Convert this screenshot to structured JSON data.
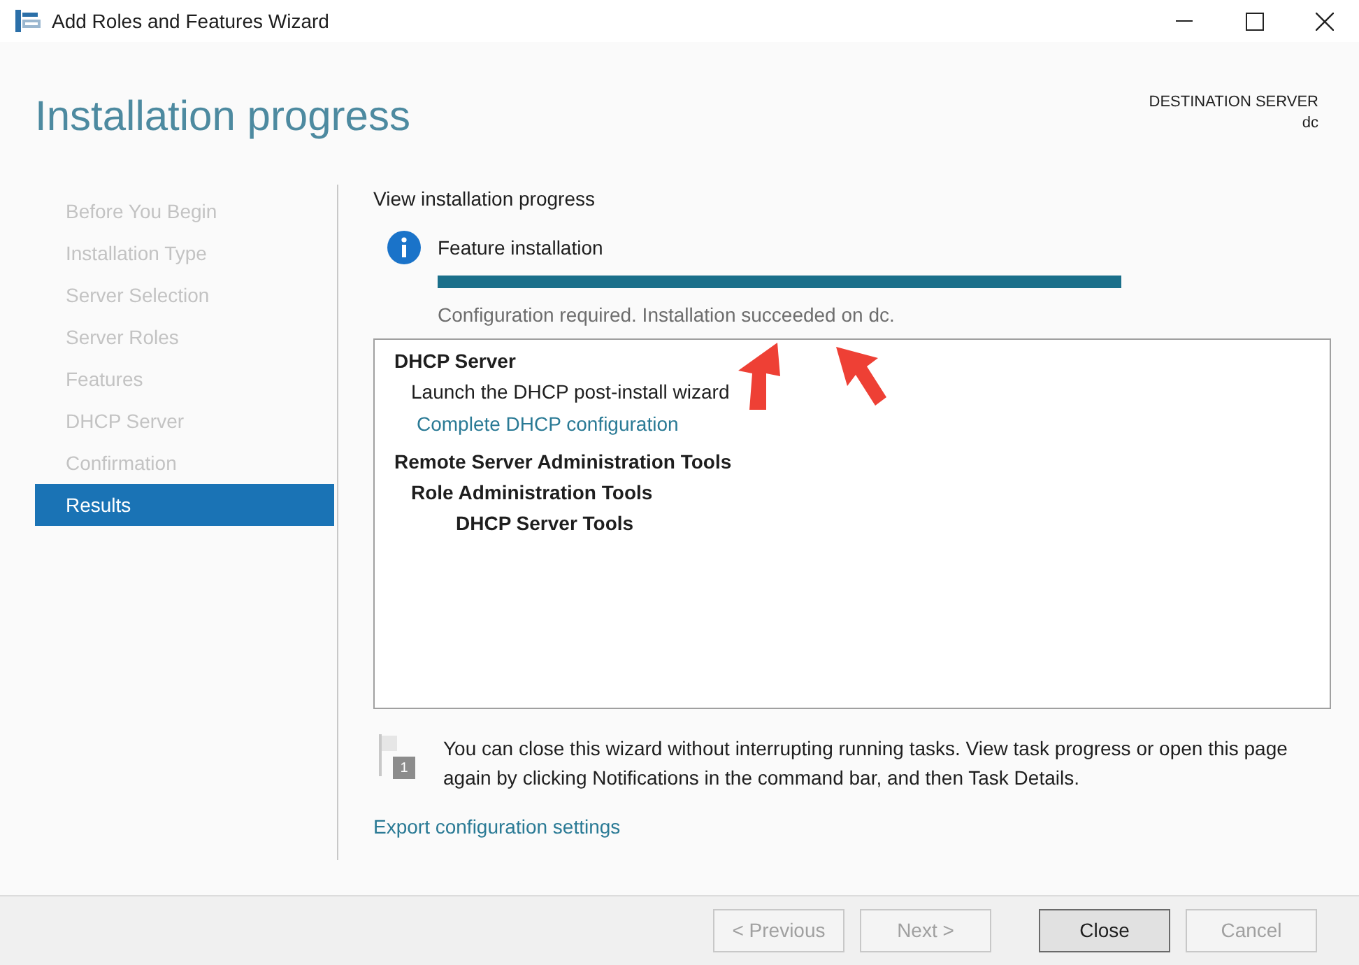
{
  "window": {
    "title": "Add Roles and Features Wizard"
  },
  "header": {
    "title": "Installation progress",
    "destination_label": "DESTINATION SERVER",
    "destination_server": "dc"
  },
  "sidebar": {
    "items": [
      {
        "label": "Before You Begin",
        "selected": false
      },
      {
        "label": "Installation Type",
        "selected": false
      },
      {
        "label": "Server Selection",
        "selected": false
      },
      {
        "label": "Server Roles",
        "selected": false
      },
      {
        "label": "Features",
        "selected": false
      },
      {
        "label": "DHCP Server",
        "selected": false
      },
      {
        "label": "Confirmation",
        "selected": false
      },
      {
        "label": "Results",
        "selected": true
      }
    ]
  },
  "content": {
    "heading": "View installation progress",
    "status_title": "Feature installation",
    "progress": {
      "level": 1
    },
    "status_message": "Configuration required. Installation succeeded on dc.",
    "results": [
      {
        "kind": "heading",
        "text": "DHCP Server",
        "children": [
          {
            "kind": "text",
            "text": "Launch the DHCP post-install wizard"
          },
          {
            "kind": "link",
            "text": "Complete DHCP configuration"
          }
        ]
      },
      {
        "kind": "heading",
        "text": "Remote Server Administration Tools",
        "children": [
          {
            "kind": "heading",
            "text": "Role Administration Tools",
            "children": [
              {
                "kind": "heading",
                "text": "DHCP Server Tools"
              }
            ]
          }
        ]
      }
    ],
    "notice": {
      "badge": "1",
      "text": "You can close this wizard without interrupting running tasks. View task progress or open this page again by clicking Notifications in the command bar, and then Task Details."
    },
    "export_link": "Export configuration settings"
  },
  "buttons": [
    {
      "label": "< Previous",
      "disabled": true,
      "default": false
    },
    {
      "label": "Next >",
      "disabled": true,
      "default": false
    },
    {
      "label": "Close",
      "disabled": false,
      "default": true
    },
    {
      "label": "Cancel",
      "disabled": true,
      "default": false
    }
  ]
}
